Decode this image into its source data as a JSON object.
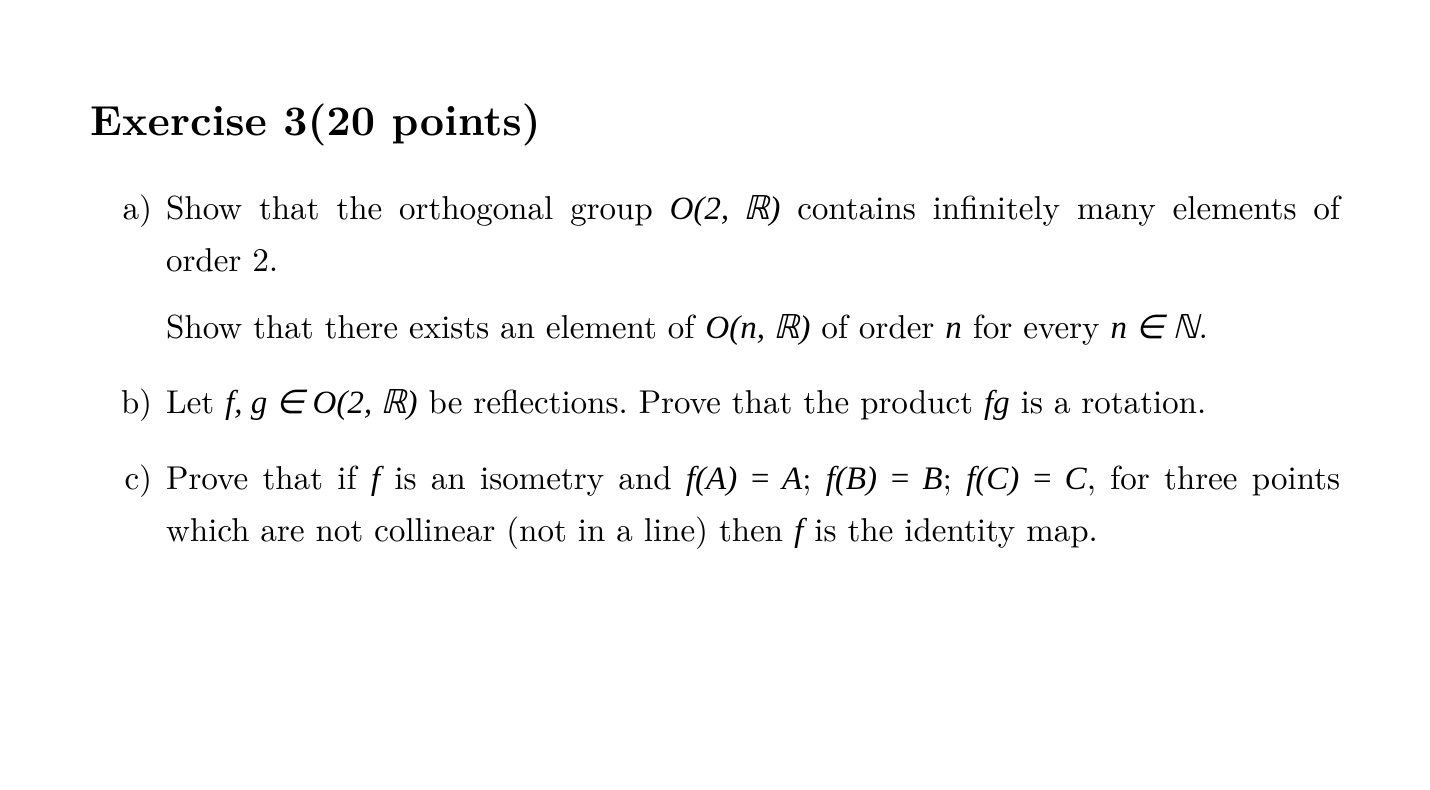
{
  "title": "Exercise 3(20 points)",
  "items": {
    "a": {
      "marker": "a)",
      "p1_pre": "Show that the orthogonal group ",
      "p1_math": "O(2, ℝ)",
      "p1_post": " contains infinitely many elements of order 2.",
      "p2_pre": "Show that there exists an element of ",
      "p2_math1": "O(n, ℝ)",
      "p2_mid": " of order ",
      "p2_n": "n",
      "p2_post": " for every ",
      "p2_cond": "n ∈ ℕ",
      "p2_end": "."
    },
    "b": {
      "marker": "b)",
      "pre": "Let ",
      "fg_in": "f, g ∈ O(2, ℝ)",
      "mid": " be reflections. Prove that the product ",
      "fg": "fg",
      "post": " is a rotation."
    },
    "c": {
      "marker": "c)",
      "pre": "Prove that if ",
      "f": "f",
      "mid1": " is an isometry and ",
      "eq1": "f(A) = A",
      "sep1": "; ",
      "eq2": "f(B) = B",
      "sep2": "; ",
      "eq3": "f(C) = C",
      "mid2": ", for three points which are not collinear (not in a line) then ",
      "f2": "f",
      "post": " is the identity map."
    }
  }
}
